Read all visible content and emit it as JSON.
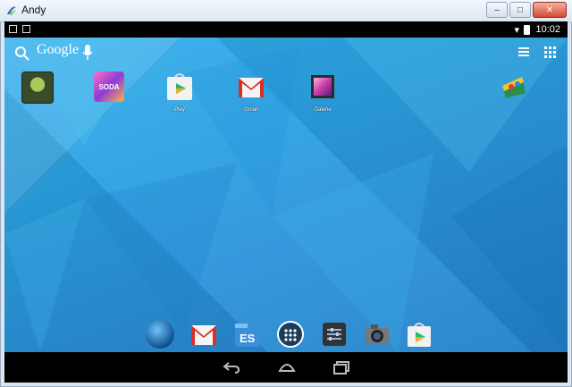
{
  "window": {
    "title": "Andy",
    "controls": {
      "minimize": "–",
      "maximize": "□",
      "close": "✕"
    }
  },
  "status_bar": {
    "time": "10:02",
    "wifi": "▾"
  },
  "home": {
    "search_label": "Google",
    "apps": [
      {
        "label": ""
      },
      {
        "label": ""
      },
      {
        "label": "Play"
      },
      {
        "label": "Gmail"
      },
      {
        "label": "Galerie"
      },
      {
        "label": ""
      }
    ]
  },
  "icons": {
    "search": "search-icon",
    "mic": "microphone-icon",
    "list": "list-icon",
    "grid": "apps-grid-icon"
  },
  "colors": {
    "wallpaper": "#2ba1e2",
    "statusbar": "#000000",
    "navbar": "#000000"
  }
}
